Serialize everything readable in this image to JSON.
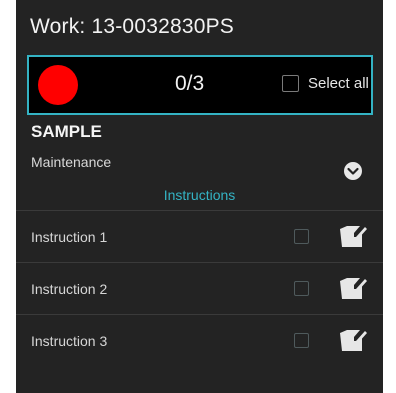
{
  "header": {
    "title": "Work: 13-0032830PS"
  },
  "progress": {
    "status_color": "#ff0000",
    "count_text": "0/3",
    "select_all_label": "Select all",
    "select_all_checked": false
  },
  "sample": {
    "title": "SAMPLE",
    "subtitle": "Maintenance"
  },
  "instructions": {
    "header": "Instructions",
    "items": [
      {
        "label": "Instruction 1",
        "checked": false
      },
      {
        "label": "Instruction 2",
        "checked": false
      },
      {
        "label": "Instruction 3",
        "checked": false
      }
    ]
  },
  "colors": {
    "background": "#232323",
    "accent": "#34b3c4",
    "status_red": "#ff0000"
  },
  "icons": {
    "expand": "chevron-down-circle-icon",
    "edit": "pencil-note-icon"
  }
}
